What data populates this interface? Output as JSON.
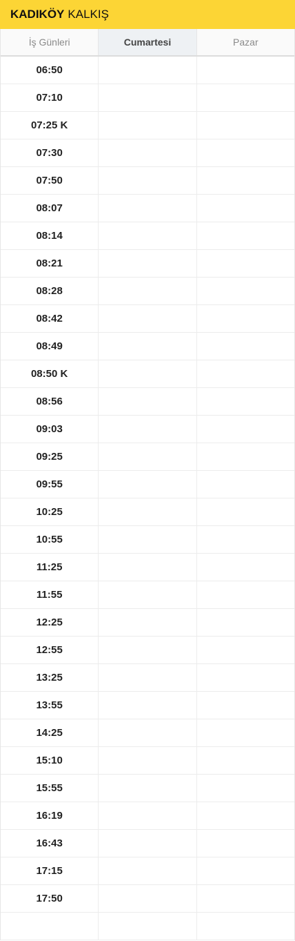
{
  "header": {
    "title_bold": "KADIKÖY",
    "title_light": "KALKIŞ"
  },
  "tabs": [
    {
      "label": "İş Günleri"
    },
    {
      "label": "Cumartesi"
    },
    {
      "label": "Pazar"
    }
  ],
  "active_tab": "Cumartesi",
  "times": [
    "06:50",
    "07:10",
    "07:25 K",
    "07:30",
    "07:50",
    "08:07",
    "08:14",
    "08:21",
    "08:28",
    "08:42",
    "08:49",
    "08:50 K",
    "08:56",
    "09:03",
    "09:25",
    "09:55",
    "10:25",
    "10:55",
    "11:25",
    "11:55",
    "12:25",
    "12:55",
    "13:25",
    "13:55",
    "14:25",
    "15:10",
    "15:55",
    "16:19",
    "16:43",
    "17:15",
    "17:50",
    ""
  ],
  "colors": {
    "header_bg": "#fcd535",
    "active_tab_bg": "#eef1f4"
  }
}
